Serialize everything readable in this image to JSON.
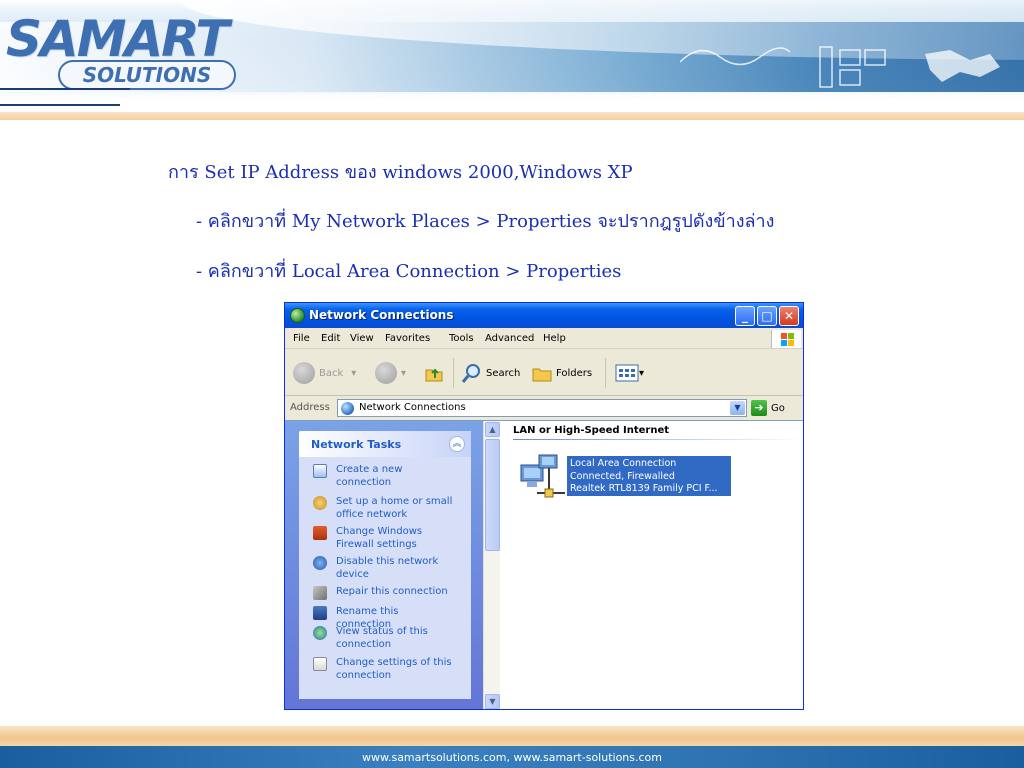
{
  "brand": {
    "name": "SAMART",
    "sub": "SOLUTIONS"
  },
  "slide": {
    "line1": "การ Set  IP Address ของ windows 2000,Windows XP",
    "line2": "- คลิกขวาที่ My Network Places > Properties จะปรากฎรูปดังข้างล่าง",
    "line3": "- คลิกขวาที่ Local Area Connection > Properties",
    "text_color": "#1a2fb0"
  },
  "window": {
    "title": "Network Connections",
    "controls": {
      "minimize": "_",
      "maximize": "□",
      "close": "✕"
    },
    "menu": [
      "File",
      "Edit",
      "View",
      "Favorites",
      "Tools",
      "Advanced",
      "Help"
    ],
    "toolbar": {
      "back": "Back",
      "search": "Search",
      "folders": "Folders"
    },
    "address": {
      "label": "Address",
      "value": "Network Connections",
      "go": "Go"
    },
    "tasks": {
      "title": "Network Tasks",
      "items": [
        {
          "label": "Create a new connection",
          "icon": "new-connection-icon"
        },
        {
          "label": "Set up a home or small office network",
          "icon": "home-network-icon"
        },
        {
          "label": "Change Windows Firewall settings",
          "icon": "firewall-icon"
        },
        {
          "label": "Disable this network device",
          "icon": "disable-icon"
        },
        {
          "label": "Repair this connection",
          "icon": "repair-icon"
        },
        {
          "label": "Rename this connection",
          "icon": "rename-icon"
        },
        {
          "label": "View status of this connection",
          "icon": "status-icon"
        },
        {
          "label": "Change settings of this connection",
          "icon": "settings-icon"
        }
      ]
    },
    "group": "LAN or High-Speed Internet",
    "connection": {
      "name": "Local Area Connection",
      "status": "Connected, Firewalled",
      "device": "Realtek RTL8139 Family PCI F..."
    },
    "accent": "#0054e3",
    "selection": "#316ac5"
  },
  "footer": {
    "text": "www.samartsolutions.com,   www.samart-solutions.com"
  }
}
